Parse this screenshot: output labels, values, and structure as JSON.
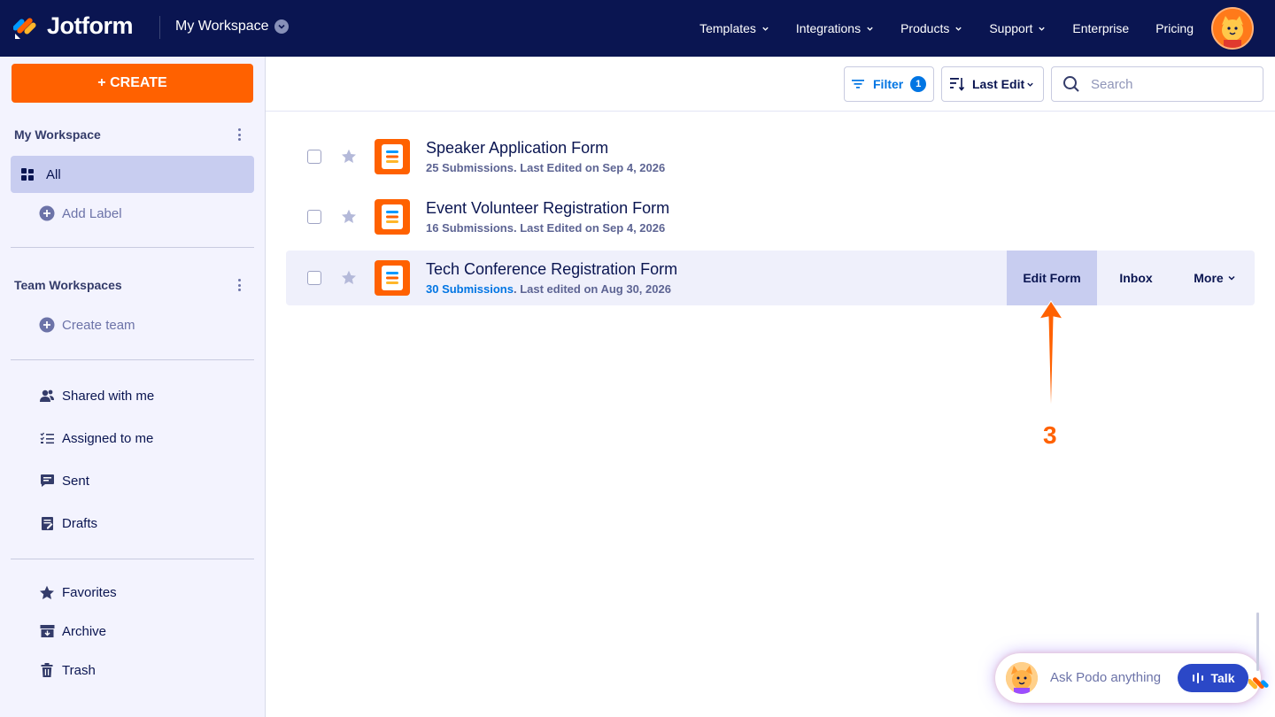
{
  "brand": {
    "name": "Jotform",
    "accent": "#ff6100",
    "navy": "#0a1551",
    "link": "#0075e3"
  },
  "header": {
    "workspace": "My Workspace",
    "nav": [
      {
        "label": "Templates",
        "has_chevron": true
      },
      {
        "label": "Integrations",
        "has_chevron": true
      },
      {
        "label": "Products",
        "has_chevron": true
      },
      {
        "label": "Support",
        "has_chevron": true
      },
      {
        "label": "Enterprise",
        "has_chevron": false
      },
      {
        "label": "Pricing",
        "has_chevron": false
      }
    ]
  },
  "sidebar": {
    "create_label": "+ CREATE",
    "my_workspace": {
      "title": "My Workspace",
      "all_label": "All",
      "add_label": "Add Label"
    },
    "team_workspaces": {
      "title": "Team Workspaces",
      "create_team": "Create team"
    },
    "items": [
      {
        "label": "Shared with me",
        "icon": "shared-users-icon"
      },
      {
        "label": "Assigned to me",
        "icon": "checklist-icon"
      },
      {
        "label": "Sent",
        "icon": "message-icon"
      },
      {
        "label": "Drafts",
        "icon": "draft-icon"
      }
    ],
    "bottom_items": [
      {
        "label": "Favorites",
        "icon": "star-icon"
      },
      {
        "label": "Archive",
        "icon": "archive-icon"
      },
      {
        "label": "Trash",
        "icon": "trash-icon"
      }
    ]
  },
  "toolbar": {
    "filter_label": "Filter",
    "filter_count": "1",
    "sort_label": "Last Edit",
    "search_placeholder": "Search"
  },
  "forms": [
    {
      "title": "Speaker Application Form",
      "submissions": "25 Submissions.",
      "edited": "Last Edited on Sep 4, 2026"
    },
    {
      "title": "Event Volunteer Registration Form",
      "submissions": "16 Submissions.",
      "edited": "Last Edited on Sep 4, 2026"
    },
    {
      "title": "Tech Conference Registration Form",
      "submissions": "30 Submissions",
      "edited": ". Last edited on Aug 30, 2026"
    }
  ],
  "row_actions": {
    "edit": "Edit Form",
    "inbox": "Inbox",
    "more": "More"
  },
  "annotation": {
    "step": "3"
  },
  "podo": {
    "prompt": "Ask Podo anything",
    "talk": "Talk"
  }
}
